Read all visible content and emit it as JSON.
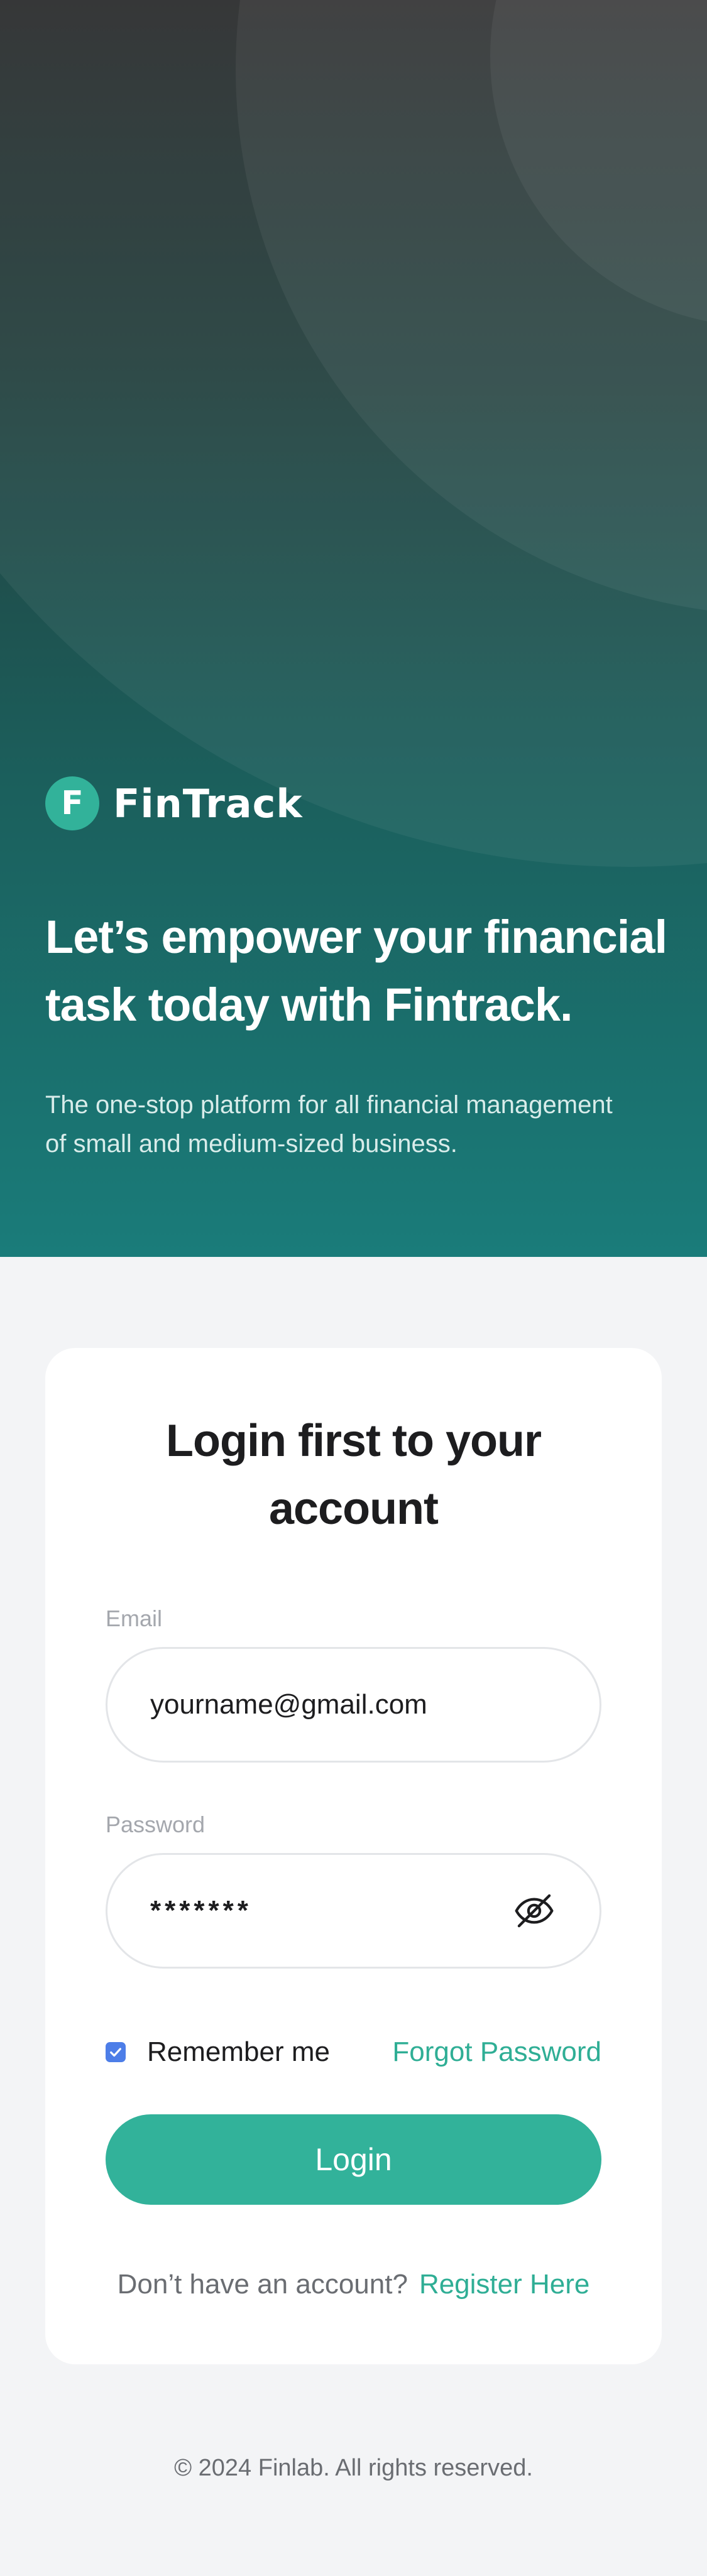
{
  "hero": {
    "brand_initial": "F",
    "brand_name": "FinTrack",
    "headline_line1": "Let’s empower your financial",
    "headline_line2": "task today with Fintrack.",
    "subline_line1": "The one-stop platform for all financial management",
    "subline_line2": "of small and medium-sized business."
  },
  "login": {
    "title_line1": "Login first to your",
    "title_line2": "account",
    "email_label": "Email",
    "email_value": "yourname@gmail.com",
    "password_label": "Password",
    "password_value": "*******",
    "password_toggle_icon": "eye-off-icon",
    "remember_label": "Remember me",
    "remember_checked": true,
    "forgot_label": "Forgot Password",
    "login_button": "Login",
    "register_prompt": "Don’t have an account?",
    "register_link": "Register Here"
  },
  "footer": {
    "copyright": "© 2024 Finlab. All rights reserved."
  },
  "colors": {
    "accent": "#32b29a",
    "accent_text": "#2fae95",
    "checkbox": "#4d7ee8",
    "hero_top": "#2b2c2d",
    "hero_bottom": "#1a7c7a",
    "page_bg": "#f3f4f6"
  }
}
